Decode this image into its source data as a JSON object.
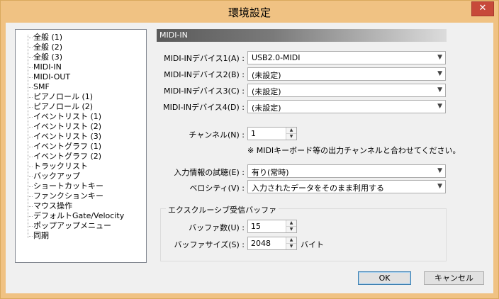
{
  "window": {
    "title": "環境設定",
    "close_glyph": "✕"
  },
  "tree": {
    "items": [
      "全般 (1)",
      "全般 (2)",
      "全般 (3)",
      "MIDI-IN",
      "MIDI-OUT",
      "SMF",
      "ピアノロール (1)",
      "ピアノロール (2)",
      "イベントリスト (1)",
      "イベントリスト (2)",
      "イベントリスト (3)",
      "イベントグラフ (1)",
      "イベントグラフ (2)",
      "トラックリスト",
      "バックアップ",
      "ショートカットキー",
      "ファンクションキー",
      "マウス操作",
      "デフォルトGate/Velocity",
      "ポップアップメニュー",
      "同期"
    ]
  },
  "section": {
    "title": "MIDI-IN"
  },
  "devices": [
    {
      "label": "MIDI-INデバイス1(A) :",
      "value": "USB2.0-MIDI"
    },
    {
      "label": "MIDI-INデバイス2(B) :",
      "value": "(未設定)"
    },
    {
      "label": "MIDI-INデバイス3(C) :",
      "value": "(未設定)"
    },
    {
      "label": "MIDI-INデバイス4(D) :",
      "value": "(未設定)"
    }
  ],
  "channel": {
    "label": "チャンネル(N) :",
    "value": "1",
    "note": "※ MIDIキーボード等の出力チャンネルと合わせてください。"
  },
  "input_audition": {
    "label": "入力情報の試聴(E) :",
    "value": "有り(常時)"
  },
  "velocity": {
    "label": "ベロシティ(V) :",
    "value": "入力されたデータをそのまま利用する"
  },
  "exclusive": {
    "title": "エクスクルーシブ受信バッファ",
    "buffer_count": {
      "label": "バッファ数(U) :",
      "value": "15"
    },
    "buffer_size": {
      "label": "バッファサイズ(S) :",
      "value": "2048",
      "unit": "バイト"
    }
  },
  "buttons": {
    "ok": "OK",
    "cancel": "キャンセル"
  },
  "icons": {
    "dropdown": "▼",
    "spin_up": "▲",
    "spin_down": "▼"
  }
}
